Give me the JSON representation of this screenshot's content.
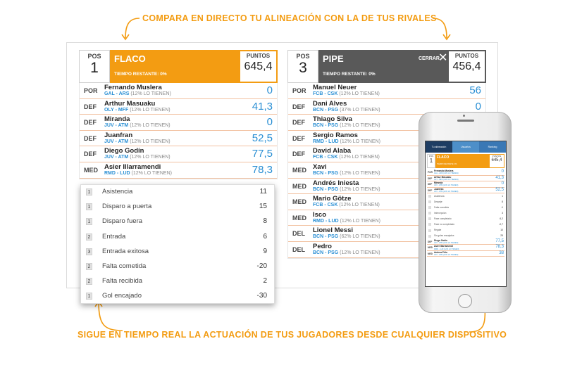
{
  "headlines": {
    "top": "COMPARA EN DIRECTO TU ALINEACIÓN CON LA DE TUS RIVALES",
    "bottom": "SIGUE EN TIEMPO REAL LA ACTUACIÓN DE TUS JUGADORES DESDE CUALQUIER DISPOSITIVO"
  },
  "colors": {
    "accent": "#f39c12",
    "dark": "#595959",
    "link": "#2a8fd4"
  },
  "left_team": {
    "pos_label": "POS",
    "pos": "1",
    "name": "FLACO",
    "time_remaining": "TIEMPO RESTANTE: 0%",
    "points_label": "PUNTOS",
    "points": "645,4",
    "players": [
      {
        "pos": "POR",
        "name": "Fernando Muslera",
        "teams": "GAL - ARS",
        "owners": "(12% LO TIENEN)",
        "points": "0"
      },
      {
        "pos": "DEF",
        "name": "Arthur Masuaku",
        "teams": "OLY - MFF",
        "owners": "(12% LO TIENEN)",
        "points": "41,3"
      },
      {
        "pos": "DEF",
        "name": "Miranda",
        "teams": "JUV - ATM",
        "owners": "(12% LO TIENEN)",
        "points": "0"
      },
      {
        "pos": "DEF",
        "name": "Juanfran",
        "teams": "JUV - ATM",
        "owners": "(12% LO TIENEN)",
        "points": "52,5"
      },
      {
        "pos": "DEF",
        "name": "Diego Godín",
        "teams": "JUV - ATM",
        "owners": "(12% LO TIENEN)",
        "points": "77,5"
      },
      {
        "pos": "MED",
        "name": "Asier Illarramendi",
        "teams": "RMD - LUD",
        "owners": "(12% LO TIENEN)",
        "points": "78,3"
      }
    ]
  },
  "right_team": {
    "pos_label": "POS",
    "pos": "3",
    "name": "PIPE",
    "close_label": "CERRAR",
    "close_icon": "✕",
    "time_remaining": "TIEMPO RESTANTE: 0%",
    "points_label": "PUNTOS",
    "points": "456,4",
    "players": [
      {
        "pos": "POR",
        "name": "Manuel Neuer",
        "teams": "FCB - CSK",
        "owners": "(12% LO TIENEN)",
        "points": "56"
      },
      {
        "pos": "DEF",
        "name": "Dani Alves",
        "teams": "BCN - PSG",
        "owners": "(37% LO TIENEN)",
        "points": "0"
      },
      {
        "pos": "DEF",
        "name": "Thiago Silva",
        "teams": "BCN - PSG",
        "owners": "(12% LO TIENEN)",
        "points": ""
      },
      {
        "pos": "DEF",
        "name": "Sergio Ramos",
        "teams": "RMD - LUD",
        "owners": "(12% LO TIENEN)",
        "points": ""
      },
      {
        "pos": "DEF",
        "name": "David Alaba",
        "teams": "FCB - CSK",
        "owners": "(12% LO TIENEN)",
        "points": ""
      },
      {
        "pos": "MED",
        "name": "Xavi",
        "teams": "BCN - PSG",
        "owners": "(12% LO TIENEN)",
        "points": ""
      },
      {
        "pos": "MED",
        "name": "Andrés Iniesta",
        "teams": "BCN - PSG",
        "owners": "(12% LO TIENEN)",
        "points": ""
      },
      {
        "pos": "MED",
        "name": "Mario Götze",
        "teams": "FCB - CSK",
        "owners": "(12% LO TIENEN)",
        "points": ""
      },
      {
        "pos": "MED",
        "name": "Isco",
        "teams": "RMD - LUD",
        "owners": "(12% LO TIENEN)",
        "points": ""
      },
      {
        "pos": "DEL",
        "name": "Lionel Messi",
        "teams": "BCN - PSG",
        "owners": "(62% LO TIENEN)",
        "points": ""
      },
      {
        "pos": "DEL",
        "name": "Pedro",
        "teams": "BCN - PSG",
        "owners": "(12% LO TIENEN)",
        "points": ""
      }
    ]
  },
  "stats": [
    {
      "qty": "1",
      "name": "Asistencia",
      "value": "11"
    },
    {
      "qty": "1",
      "name": "Disparo a puerta",
      "value": "15"
    },
    {
      "qty": "1",
      "name": "Disparo fuera",
      "value": "8"
    },
    {
      "qty": "2",
      "name": "Entrada",
      "value": "6"
    },
    {
      "qty": "3",
      "name": "Entrada exitosa",
      "value": "9"
    },
    {
      "qty": "2",
      "name": "Falta cometida",
      "value": "-20"
    },
    {
      "qty": "2",
      "name": "Falta recibida",
      "value": "2"
    },
    {
      "qty": "1",
      "name": "Gol encajado",
      "value": "-30"
    }
  ],
  "phone": {
    "tabs": [
      "Tu alineación",
      "Usuarios",
      "Ranking"
    ],
    "pos_label": "POS",
    "pos": "1",
    "name": "FLACO",
    "time_remaining": "TIEMPO RESTANTE: 0%",
    "points_label": "PUNTOS",
    "points": "645,4",
    "players_top": [
      {
        "pos": "POR",
        "name": "Fernando Muslera",
        "sub": "GAL - ARS (12% LO TIENEN)",
        "points": "0"
      },
      {
        "pos": "DEF",
        "name": "Arthur Masuaku",
        "sub": "OLY - MFF (12% LO TIENEN)",
        "points": "41,3"
      },
      {
        "pos": "DEF",
        "name": "Miranda",
        "sub": "JUV - ATM (12% LO TIENEN)",
        "points": "0"
      },
      {
        "pos": "DEF",
        "name": "Juanfran",
        "sub": "JUV - ATM (12% LO TIENEN)",
        "points": "52,5"
      }
    ],
    "stats": [
      {
        "name": "Asistencia",
        "value": "1"
      },
      {
        "name": "Despeje",
        "value": "8"
      },
      {
        "name": "Falta cometida",
        "value": "-1"
      },
      {
        "name": "Intercepción",
        "value": "3"
      },
      {
        "name": "Pase completado",
        "value": "6,2"
      },
      {
        "name": "Pase no completado",
        "value": "-0,7"
      },
      {
        "name": "Regate",
        "value": "10"
      },
      {
        "name": "Sin goles encajados",
        "value": "25"
      }
    ],
    "players_bottom": [
      {
        "pos": "DEF",
        "name": "Diego Godín",
        "sub": "JUV - ATM (12% LO TIENEN)",
        "points": "77,5"
      },
      {
        "pos": "MED",
        "name": "Asier Illarramendi",
        "sub": "RMD - LUD (12% LO TIENEN)",
        "points": "78,3"
      },
      {
        "pos": "MED",
        "name": "Andrea Pirlo",
        "sub": "JUV - ATM (12% LO TIENEN)",
        "points": "38"
      }
    ]
  }
}
